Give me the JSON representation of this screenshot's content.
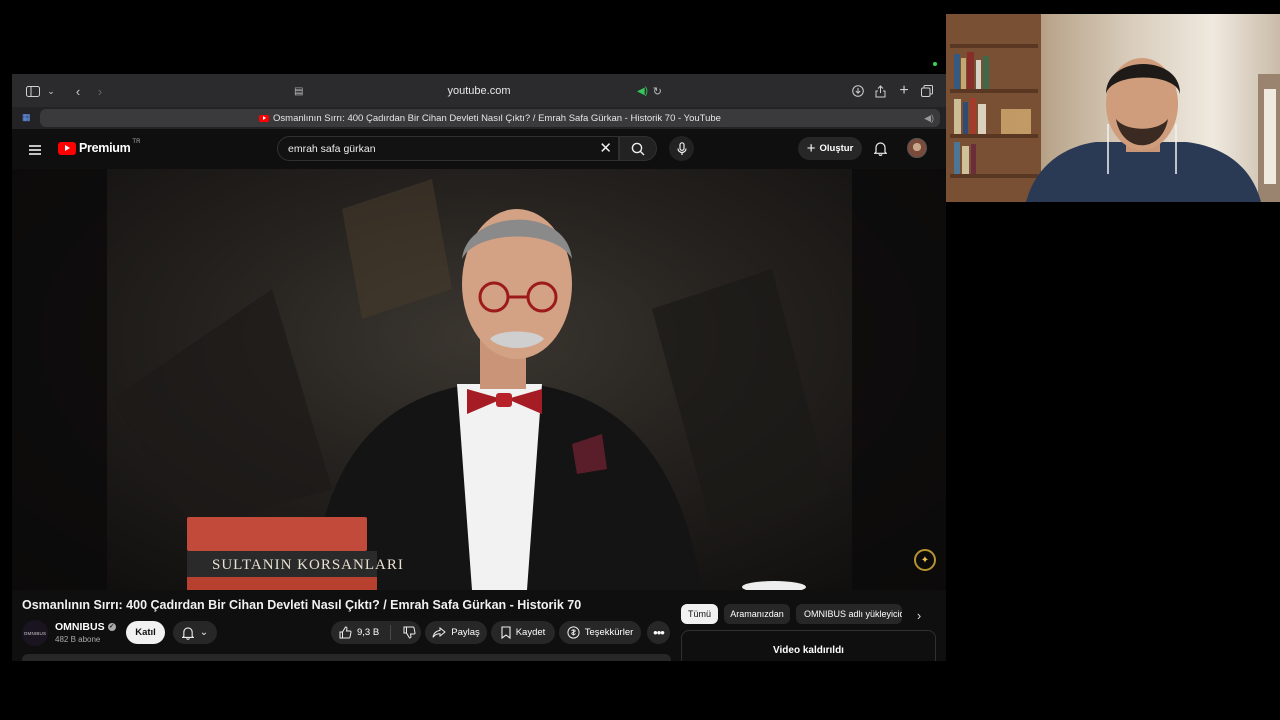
{
  "browser": {
    "url": "youtube.com",
    "tab_title": "Osmanlının Sırrı: 400 Çadırdan Bir Cihan Devleti Nasıl Çıktı? / Emrah Safa Gürkan - Historik 70 - YouTube"
  },
  "youtube": {
    "logo_text": "Premium",
    "region": "TR",
    "search_value": "emrah safa gürkan",
    "create_label": "Oluştur",
    "video": {
      "title": "Osmanlının Sırrı: 400 Çadırdan Bir Cihan Devleti Nasıl Çıktı? / Emrah Safa Gürkan - Historik 70",
      "channel_avatar_text": "OMNIBUS",
      "channel_name": "OMNIBUS",
      "subscribers": "482 B abone",
      "join_label": "Katıl",
      "likes": "9,3 B",
      "share_label": "Paylaş",
      "save_label": "Kaydet",
      "thanks_label": "Teşekkürler"
    },
    "chips": [
      "Tümü",
      "Aramanızdan",
      "OMNIBUS adlı yükleyiciden"
    ],
    "removed_label": "Video kaldırıldı"
  },
  "colors": {
    "accent": "#ff0000",
    "background": "#0f0f0f",
    "chip_bg": "#272727"
  }
}
